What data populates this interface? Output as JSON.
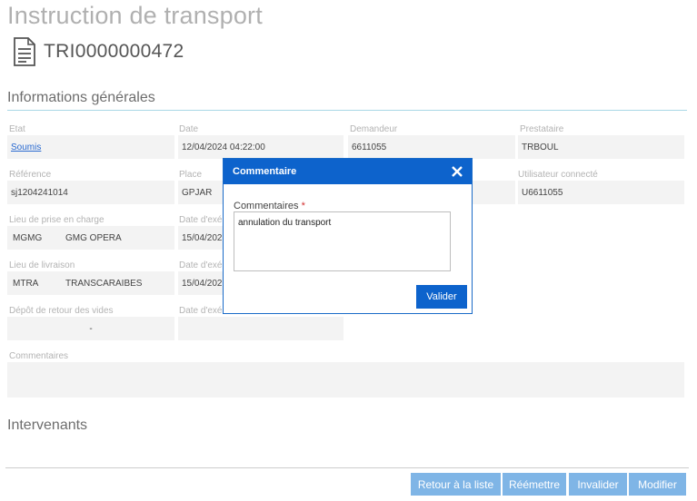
{
  "header": {
    "title": "Instruction de transport",
    "doc_id": "TRI0000000472"
  },
  "sections": {
    "general": "Informations générales",
    "intervenants": "Intervenants"
  },
  "fields": {
    "etat": {
      "label": "Etat",
      "value": "Soumis"
    },
    "date": {
      "label": "Date",
      "value": "12/04/2024 04:22:00"
    },
    "demandeur": {
      "label": "Demandeur",
      "value": "6611055"
    },
    "prestataire": {
      "label": "Prestataire",
      "value": "TRBOUL"
    },
    "reference": {
      "label": "Référence",
      "value": "sj1204241014"
    },
    "place": {
      "label": "Place",
      "value": "GPJAR"
    },
    "utilisateur": {
      "label": "Utilisateur connecté",
      "value": "U6611055"
    },
    "prise_en_charge": {
      "label": "Lieu de prise en charge",
      "code": "MGMG",
      "name": "GMG OPERA"
    },
    "date_exec_1": {
      "label": "Date d'exé",
      "value": "15/04/202"
    },
    "livraison": {
      "label": "Lieu de livraison",
      "code": "MTRA",
      "name": "TRANSCARAIBES"
    },
    "date_exec_2": {
      "label": "Date d'exé",
      "value": "15/04/202"
    },
    "depot_retour": {
      "label": "Dépôt de retour des vides",
      "value": "-"
    },
    "date_exec_3": {
      "label": "Date d'exé",
      "value": ""
    },
    "commentaires": {
      "label": "Commentaires",
      "value": ""
    }
  },
  "buttons": {
    "retour": "Retour à la liste",
    "reemettre": "Réémettre",
    "invalider": "Invalider",
    "modifier": "Modifier"
  },
  "modal": {
    "title": "Commentaire",
    "label": "Commentaires",
    "required_mark": "*",
    "textarea_value": "annulation du transport",
    "submit": "Valider"
  },
  "colors": {
    "primary": "#0d63cc",
    "button_light": "#7fb5e6",
    "link": "#2a6ad0",
    "field_bg": "#f3f3f3",
    "section_line": "#a9d8e6"
  }
}
